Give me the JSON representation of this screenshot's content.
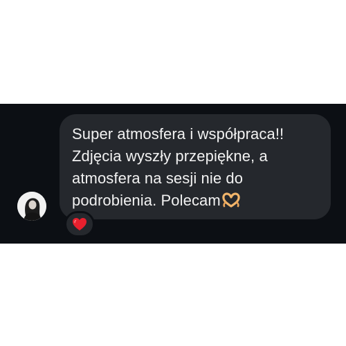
{
  "message": {
    "text": "Super atmosfera i współpraca!!\nZdjęcia wyszły przepiękne, a\natmosfera na sesji nie do\npodrobienia. Polecam",
    "trailing_emoji": "heart-hands-icon"
  },
  "reaction": {
    "emoji": "red-heart-icon"
  },
  "colors": {
    "background": "#0c0f14",
    "bubble": "#25282d",
    "text": "#f2f2f2",
    "heart": "#e8202e"
  }
}
